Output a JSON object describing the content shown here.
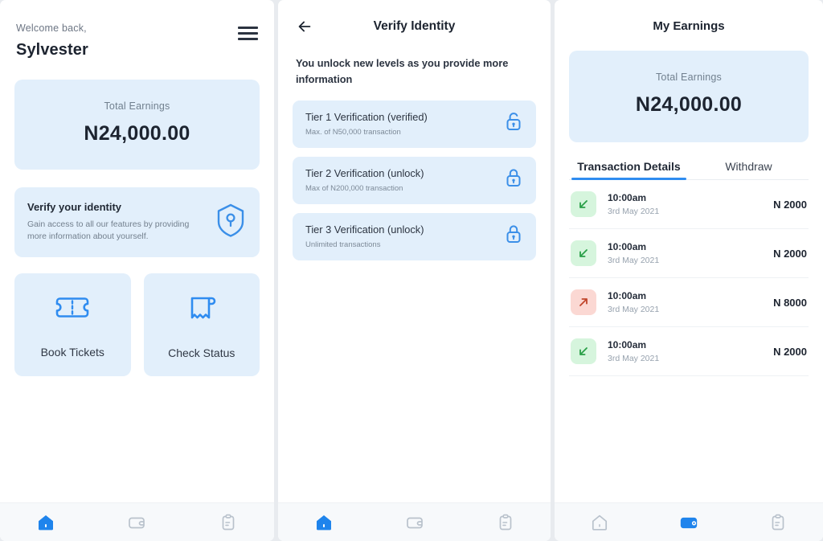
{
  "panel_home": {
    "welcome_label": "Welcome back,",
    "user_name": "Sylvester",
    "menu_icon": "hamburger-menu-icon",
    "earnings_card": {
      "label": "Total Earnings",
      "value": "N24,000.00"
    },
    "verify_card": {
      "title": "Verify your identity",
      "description": "Gain access to all our features by providing more information about yourself.",
      "icon": "shield-key-icon"
    },
    "quick_actions": [
      {
        "label": "Book Tickets",
        "icon": "ticket-icon"
      },
      {
        "label": "Check Status",
        "icon": "receipt-icon"
      }
    ],
    "nav": [
      {
        "name": "home",
        "icon": "home-icon",
        "active": true
      },
      {
        "name": "wallet",
        "icon": "wallet-icon",
        "active": false
      },
      {
        "name": "orders",
        "icon": "clipboard-icon",
        "active": false
      }
    ]
  },
  "panel_verify": {
    "back_icon": "back-arrow-icon",
    "title": "Verify Identity",
    "subtitle": "You unlock new levels as you provide more information",
    "tiers": [
      {
        "title": "Tier 1 Verification (verified)",
        "subtitle": "Max. of N50,000 transaction",
        "icon": "unlock-icon",
        "state": "unlocked"
      },
      {
        "title": "Tier 2 Verification (unlock)",
        "subtitle": "Max of N200,000 transaction",
        "icon": "lock-icon",
        "state": "locked"
      },
      {
        "title": "Tier 3 Verification (unlock)",
        "subtitle": "Unlimited transactions",
        "icon": "lock-icon",
        "state": "locked"
      }
    ],
    "nav": [
      {
        "name": "home",
        "icon": "home-icon",
        "active": true
      },
      {
        "name": "wallet",
        "icon": "wallet-icon",
        "active": false
      },
      {
        "name": "orders",
        "icon": "clipboard-icon",
        "active": false
      }
    ]
  },
  "panel_earnings": {
    "title": "My Earnings",
    "earnings_card": {
      "label": "Total Earnings",
      "value": "N24,000.00"
    },
    "tabs": [
      {
        "label": "Transaction Details",
        "active": true
      },
      {
        "label": "Withdraw",
        "active": false
      }
    ],
    "transactions": [
      {
        "time": "10:00am",
        "date": "3rd May 2021",
        "amount": "N 2000",
        "direction": "in",
        "icon": "arrow-down-left-icon"
      },
      {
        "time": "10:00am",
        "date": "3rd May 2021",
        "amount": "N 2000",
        "direction": "in",
        "icon": "arrow-down-left-icon"
      },
      {
        "time": "10:00am",
        "date": "3rd May 2021",
        "amount": "N 8000",
        "direction": "out",
        "icon": "arrow-up-right-icon"
      },
      {
        "time": "10:00am",
        "date": "3rd May 2021",
        "amount": "N 2000",
        "direction": "in",
        "icon": "arrow-down-left-icon"
      }
    ],
    "nav": [
      {
        "name": "home",
        "icon": "home-icon",
        "active": false
      },
      {
        "name": "wallet",
        "icon": "wallet-icon",
        "active": true
      },
      {
        "name": "orders",
        "icon": "clipboard-icon",
        "active": false
      }
    ]
  },
  "colors": {
    "accent_blue": "#2f8cf0",
    "card_tint": "#e2effb",
    "incoming_bg": "#d6f5dd",
    "incoming_fg": "#2aa048",
    "outgoing_bg": "#fbd8d3",
    "outgoing_fg": "#c0452b",
    "nav_inactive": "#b9c2cc"
  }
}
